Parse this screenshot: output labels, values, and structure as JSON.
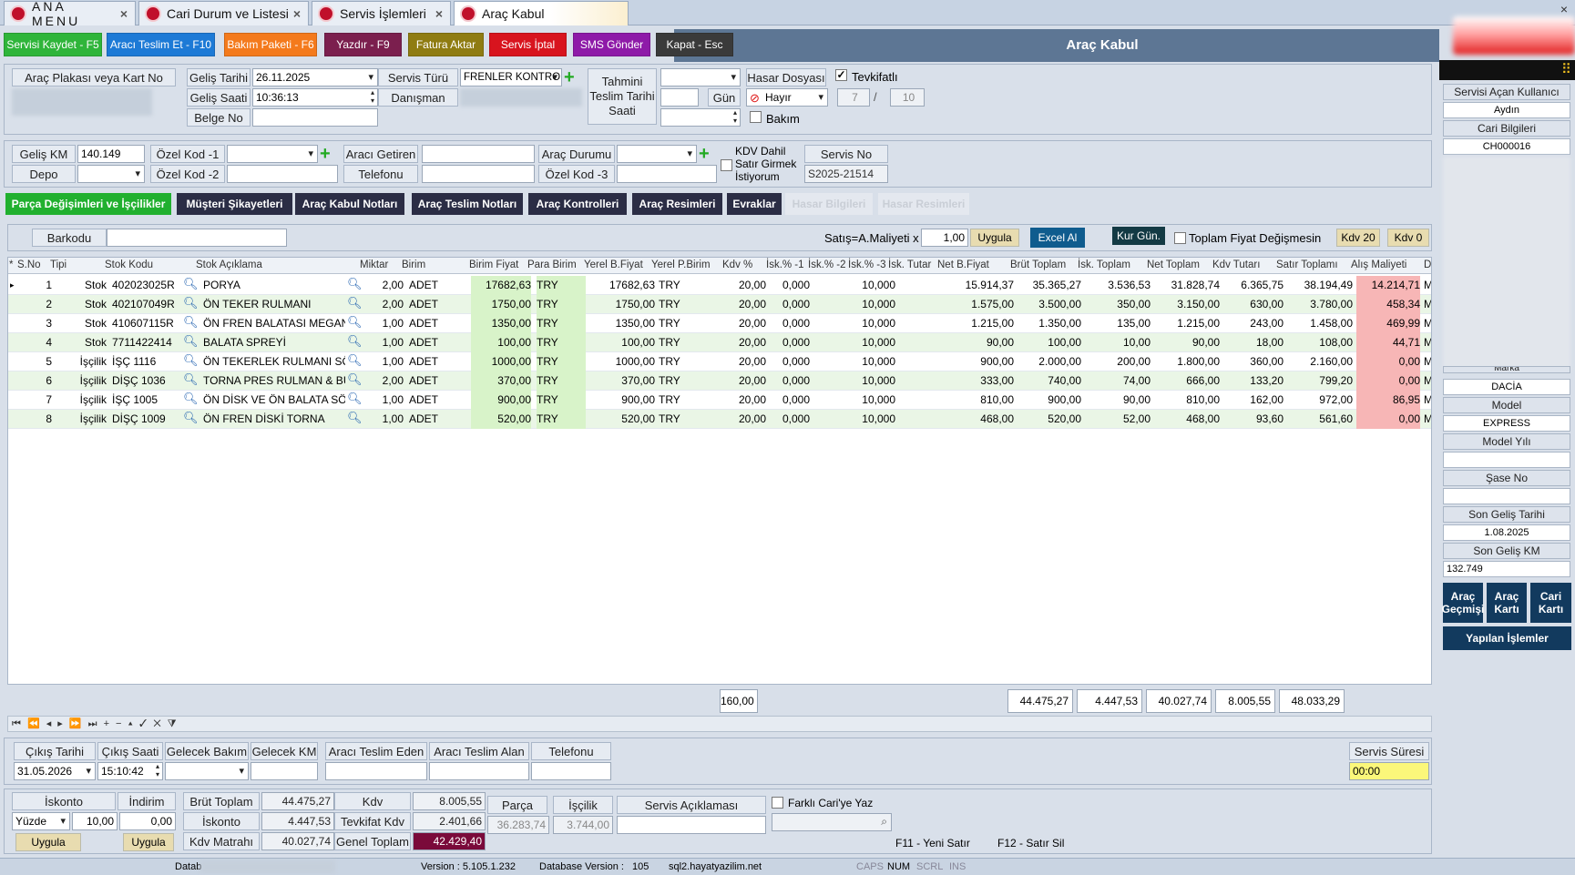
{
  "tabs": [
    {
      "label": "ANA MENU",
      "active": false
    },
    {
      "label": "Cari Durum ve Listesi",
      "active": false
    },
    {
      "label": "Servis İşlemleri",
      "active": false
    },
    {
      "label": "Araç Kabul",
      "active": true
    }
  ],
  "window_close": "×",
  "toolbar": {
    "buttons": [
      {
        "label": "Servisi Kaydet - F5",
        "color": "#2fb53a"
      },
      {
        "label": "Aracı Teslim Et - F10",
        "color": "#1d7ad6"
      },
      {
        "label": "Bakım Paketi - F6",
        "color": "#f47a1c"
      },
      {
        "label": "Yazdır - F9",
        "color": "#7b1f4e"
      },
      {
        "label": "Fatura Aktar",
        "color": "#8f7c12"
      },
      {
        "label": "Servis İptal",
        "color": "#d8141e"
      },
      {
        "label": "SMS Gönder",
        "color": "#8e1aa8"
      },
      {
        "label": "Kapat - Esc",
        "color": "#3a3a3a"
      }
    ],
    "page_title": "Araç Kabul"
  },
  "form1": {
    "plate_label": "Araç Plakası veya Kart No",
    "gelis_tarihi_label": "Geliş Tarihi",
    "gelis_tarihi": "26.11.2025",
    "gelis_saati_label": "Geliş Saati",
    "gelis_saati": "10:36:13",
    "belge_no_label": "Belge No",
    "belge_no": "",
    "servis_turu_label": "Servis Türü",
    "servis_turu": "FRENLER KONTROL",
    "danisman_label": "Danışman",
    "tahmini_label": "Tahmini\nTeslim Tarihi\nSaati",
    "gun_label": "Gün",
    "hasar_dosyasi_label": "Hasar Dosyası",
    "hasar_value": "Hayır",
    "tevkifatli_label": "Tevkifatlı",
    "tev1": "7",
    "tev_sep": "/",
    "tev2": "10",
    "bakim_label": "Bakım"
  },
  "form2": {
    "gelis_km_label": "Geliş KM",
    "gelis_km": "140.149",
    "depo_label": "Depo",
    "ozel1_label": "Özel Kod -1",
    "ozel2_label": "Özel Kod -2",
    "ozel3_label": "Özel Kod -3",
    "araci_getiren_label": "Aracı Getiren",
    "telefonu_label": "Telefonu",
    "arac_durumu_label": "Araç Durumu",
    "kdv_dahil_label": "KDV Dahil\nSatır Girmek\nİstiyorum",
    "servis_no_label": "Servis No",
    "servis_no": "S2025-21514"
  },
  "section_tabs": [
    {
      "label": "Parça Değişimleri ve İşçilikler",
      "active": true
    },
    {
      "label": "Müşteri Şikayetleri"
    },
    {
      "label": "Araç Kabul Notları"
    },
    {
      "label": "Araç Teslim Notları"
    },
    {
      "label": "Araç Kontrolleri"
    },
    {
      "label": "Araç Resimleri"
    },
    {
      "label": "Evraklar"
    },
    {
      "label": "Hasar Bilgileri",
      "disabled": true
    },
    {
      "label": "Hasar Resimleri",
      "disabled": true
    }
  ],
  "gridbar": {
    "barkodu_label": "Barkodu",
    "satis_label": "Satış=A.Maliyeti x",
    "satis_value": "1,00",
    "uygula": "Uygula",
    "excel": "Excel Al",
    "kur": "Kur Gün.",
    "toplam_fiyat": "Toplam Fiyat Değişmesin",
    "kdv20": "Kdv 20",
    "kdv0": "Kdv 0"
  },
  "grid": {
    "headers": [
      "S.No",
      "Tipi",
      "Stok Kodu",
      "Stok Açıklama",
      "Miktar",
      "Birim",
      "Birim Fiyat",
      "Para Birim",
      "Yerel B.Fiyat",
      "Yerel P.Birim",
      "Kdv %",
      "İsk.% -1",
      "İsk.% -2",
      "İsk.% -3",
      "İsk. Tutar",
      "Net B.Fiyat",
      "Brüt Toplam",
      "İsk. Toplam",
      "Net Toplam",
      "Kdv Tutarı",
      "Satır Toplamı",
      "Alış Maliyeti",
      "De"
    ],
    "rows": [
      [
        "1",
        "Stok",
        "402023025R",
        "PORYA",
        "2,00",
        "ADET",
        "17682,63",
        "TRY",
        "17682,63",
        "TRY",
        "20,00",
        "0,000",
        "",
        "10,000",
        "",
        "15.914,37",
        "35.365,27",
        "3.536,53",
        "31.828,74",
        "6.365,75",
        "38.194,49",
        "14.214,71",
        "ME"
      ],
      [
        "2",
        "Stok",
        "402107049R",
        "ÖN TEKER RULMANI",
        "2,00",
        "ADET",
        "1750,00",
        "TRY",
        "1750,00",
        "TRY",
        "20,00",
        "0,000",
        "",
        "10,000",
        "",
        "1.575,00",
        "3.500,00",
        "350,00",
        "3.150,00",
        "630,00",
        "3.780,00",
        "458,34",
        "ME"
      ],
      [
        "3",
        "Stok",
        "410607115R",
        "ÖN FREN BALATASI MEGANE",
        "1,00",
        "ADET",
        "1350,00",
        "TRY",
        "1350,00",
        "TRY",
        "20,00",
        "0,000",
        "",
        "10,000",
        "",
        "1.215,00",
        "1.350,00",
        "135,00",
        "1.215,00",
        "243,00",
        "1.458,00",
        "469,99",
        "ME"
      ],
      [
        "4",
        "Stok",
        "7711422414",
        "BALATA SPREYİ",
        "1,00",
        "ADET",
        "100,00",
        "TRY",
        "100,00",
        "TRY",
        "20,00",
        "0,000",
        "",
        "10,000",
        "",
        "90,00",
        "100,00",
        "10,00",
        "90,00",
        "18,00",
        "108,00",
        "44,71",
        "ME"
      ],
      [
        "5",
        "İşçilik",
        "İŞÇ 1116",
        "ÖN TEKERLEK RULMANI SÖKÜ",
        "1,00",
        "ADET",
        "1000,00",
        "TRY",
        "1000,00",
        "TRY",
        "20,00",
        "0,000",
        "",
        "10,000",
        "",
        "900,00",
        "2.000,00",
        "200,00",
        "1.800,00",
        "360,00",
        "2.160,00",
        "0,00",
        "ME"
      ],
      [
        "6",
        "İşçilik",
        "DİŞÇ 1036",
        "TORNA PRES RULMAN & BURÇ",
        "2,00",
        "ADET",
        "370,00",
        "TRY",
        "370,00",
        "TRY",
        "20,00",
        "0,000",
        "",
        "10,000",
        "",
        "333,00",
        "740,00",
        "74,00",
        "666,00",
        "133,20",
        "799,20",
        "0,00",
        "ME"
      ],
      [
        "7",
        "İşçilik",
        "İŞÇ 1005",
        "ÖN DİSK VE ÖN BALATA SÖKÜ",
        "1,00",
        "ADET",
        "900,00",
        "TRY",
        "900,00",
        "TRY",
        "20,00",
        "0,000",
        "",
        "10,000",
        "",
        "810,00",
        "900,00",
        "90,00",
        "810,00",
        "162,00",
        "972,00",
        "86,95",
        "ME"
      ],
      [
        "8",
        "İşçilik",
        "DİŞÇ 1009",
        "ÖN FREN DİSKİ TORNA",
        "1,00",
        "ADET",
        "520,00",
        "TRY",
        "520,00",
        "TRY",
        "20,00",
        "0,000",
        "",
        "10,000",
        "",
        "468,00",
        "520,00",
        "52,00",
        "468,00",
        "93,60",
        "561,60",
        "0,00",
        "ME"
      ]
    ],
    "totals": {
      "miktar": "160,00",
      "brut": "44.475,27",
      "isk": "4.447,53",
      "net": "40.027,74",
      "kdv": "8.005,55",
      "satir": "48.033,29"
    }
  },
  "navigator": "⏮ ⏪ ◂ ▸ ⏩ ⏭ + − ▴ ✓ ✕ ⧩",
  "exit": {
    "cikis_tarihi_label": "Çıkış Tarihi",
    "cikis_tarihi": "31.05.2026",
    "cikis_saati_label": "Çıkış Saati",
    "cikis_saati": "15:10:42",
    "gelecek_bakim_label": "Gelecek Bakım",
    "gelecek_km_label": "Gelecek KM",
    "araci_teslim_eden_label": "Aracı Teslim Eden",
    "araci_teslim_alan_label": "Aracı Teslim Alan",
    "telefonu_label": "Telefonu",
    "servis_suresi_label": "Servis Süresi",
    "servis_suresi": "00:00"
  },
  "summary": {
    "iskonto_label": "İskonto",
    "indirim_label": "İndirim",
    "yuzde": "Yüzde",
    "iskonto_value": "10,00",
    "indirim_value": "0,00",
    "uygula": "Uygula",
    "brut_label": "Brüt Toplam",
    "brut": "44.475,27",
    "isk_label": "İskonto",
    "isk": "4.447,53",
    "kdv_matrahi_label": "Kdv Matrahı",
    "kdv_matrahi": "40.027,74",
    "kdv_label": "Kdv",
    "kdv": "8.005,55",
    "tevkifat_label": "Tevkifat Kdv",
    "tevkifat": "2.401,66",
    "genel_label": "Genel Toplam",
    "genel": "42.429,40",
    "parca_label": "Parça",
    "parca": "36.283,74",
    "iscilik_label": "İşçilik",
    "iscilik": "3.744,00",
    "servis_aciklama_label": "Servis Açıklaması",
    "farkli_cari": "Farklı Cari'ye Yaz",
    "f11": "F11 - Yeni Satır",
    "f12": "F12 - Satır Sil"
  },
  "side": {
    "acan_label": "Servisi Açan Kullanıcı",
    "acan": "Aydın",
    "cari_label": "Cari Bilgileri",
    "cari": "CH000016",
    "marka_label": "Marka",
    "marka": "DACİA",
    "model_label": "Model",
    "model": "EXPRESS",
    "model_yili_label": "Model Yılı",
    "sase_label": "Şase No",
    "son_gelis_tarihi_label": "Son Geliş Tarihi",
    "son_gelis_tarihi": "1.08.2025",
    "son_gelis_km_label": "Son Geliş KM",
    "son_gelis_km": "132.749",
    "btn_gecmis": "Araç\nGeçmişi",
    "btn_arac_karti": "Araç\nKartı",
    "btn_cari_karti": "Cari\nKartı",
    "yapilan": "Yapılan İşlemler"
  },
  "status": {
    "datab": "Datab",
    "version": "Version :  5.105.1.232",
    "db_version_label": "Database Version :",
    "db_version": "105",
    "server": "sql2.hayatyazilim.net",
    "caps": "CAPS",
    "num": "NUM",
    "scrl": "SCRL",
    "ins": "INS"
  }
}
